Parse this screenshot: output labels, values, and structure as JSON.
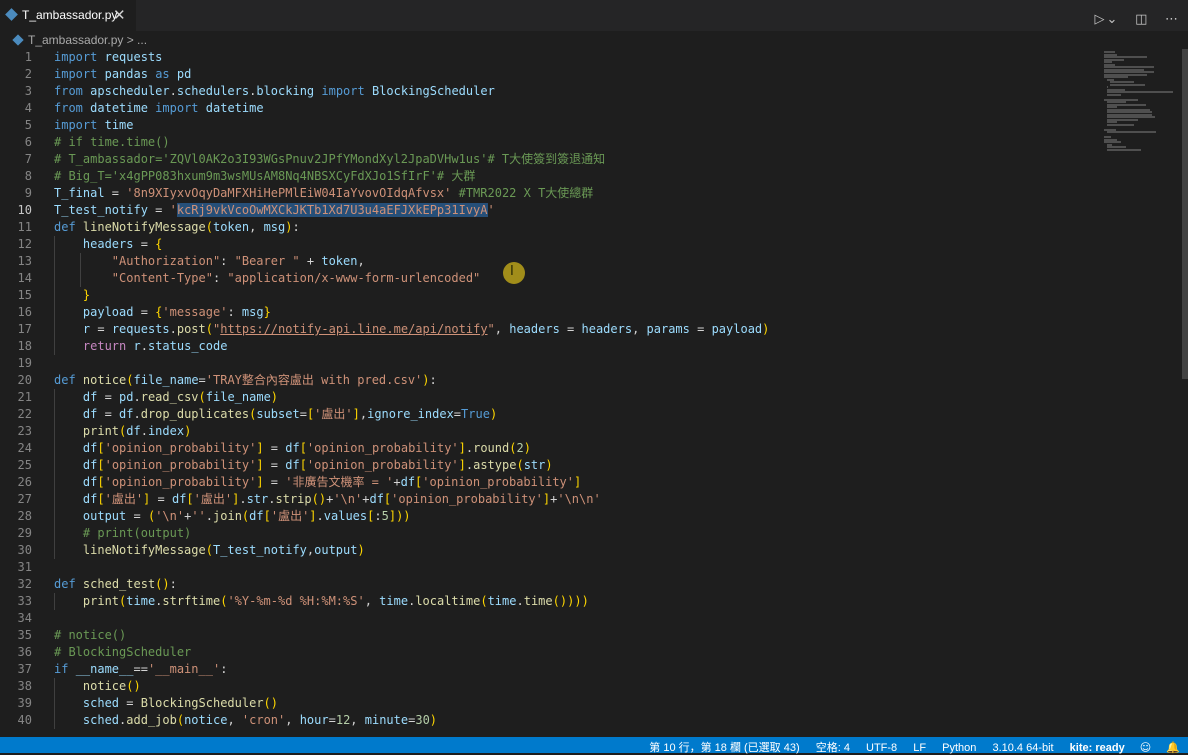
{
  "tab": {
    "filename": "T_ambassador.py",
    "close": "✕"
  },
  "actions": {
    "run": "▷",
    "run_menu": "⌄",
    "split": "◫",
    "more": "⋯"
  },
  "breadcrumb": {
    "text": "T_ambassador.py > ..."
  },
  "cursor": {
    "glyph": "I"
  },
  "editor": {
    "current_line": 10
  },
  "statusbar": {
    "position": "第 10 行，第 18 欄 (已選取 43)",
    "spaces": "空格: 4",
    "encoding": "UTF-8",
    "eol": "LF",
    "language": "Python",
    "interpreter": "3.10.4 64-bit",
    "kite": "kite: ready",
    "feedback_icon": "person-feedback-icon",
    "bell_icon": "bell-icon"
  },
  "code_lines": [
    "import requests",
    "import pandas as pd",
    "from apscheduler.schedulers.blocking import BlockingScheduler",
    "from datetime import datetime",
    "import time",
    "# if time.time()",
    "# T_ambassador='ZQVl0AK2o3I93WGsPnuv2JPfYMondXyl2JpaDVHw1us'# T大使簽到簽退通知",
    "# Big_T='x4gPP083hxum9m3wsMUsAM8Nq4NBSXCyFdXJo1SfIrF'# 大群",
    "T_final = '8n9XIyxvOqyDaMFXHiHePMlEiW04IaYvovOIdqAfvsx' #TMR2022 X T大使總群",
    "T_test_notify = 'kcRj9vkVcoOwMXCkJKTb1Xd7U3u4aEFJXkEPp31IvyA'",
    "def lineNotifyMessage(token, msg):",
    "    headers = {",
    "        \"Authorization\": \"Bearer \" + token,",
    "        \"Content-Type\": \"application/x-www-form-urlencoded\"",
    "    }",
    "    payload = {'message': msg}",
    "    r = requests.post(\"https://notify-api.line.me/api/notify\", headers = headers, params = payload)",
    "    return r.status_code",
    "",
    "def notice(file_name='TRAY整合內容盧出 with pred.csv'):",
    "    df = pd.read_csv(file_name)",
    "    df = df.drop_duplicates(subset=['盧出'],ignore_index=True)",
    "    print(df.index)",
    "    df['opinion_probability'] = df['opinion_probability'].round(2)",
    "    df['opinion_probability'] = df['opinion_probability'].astype(str)",
    "    df['opinion_probability'] = '非廣告文機率 = '+df['opinion_probability']",
    "    df['盧出'] = df['盧出'].str.strip()+'\\n'+df['opinion_probability']+'\\n\\n'",
    "    output = ('\\n'+''.join(df['盧出'].values[:5]))",
    "    # print(output)",
    "    lineNotifyMessage(T_test_notify,output)",
    "",
    "def sched_test():",
    "    print(time.strftime('%Y-%m-%d %H:%M:%S', time.localtime(time.time())))",
    "",
    "# notice()",
    "# BlockingScheduler",
    "if __name__=='__main__':",
    "    notice()",
    "    sched = BlockingScheduler()",
    "    sched.add_job(notice, 'cron', hour=12, minute=30)"
  ]
}
